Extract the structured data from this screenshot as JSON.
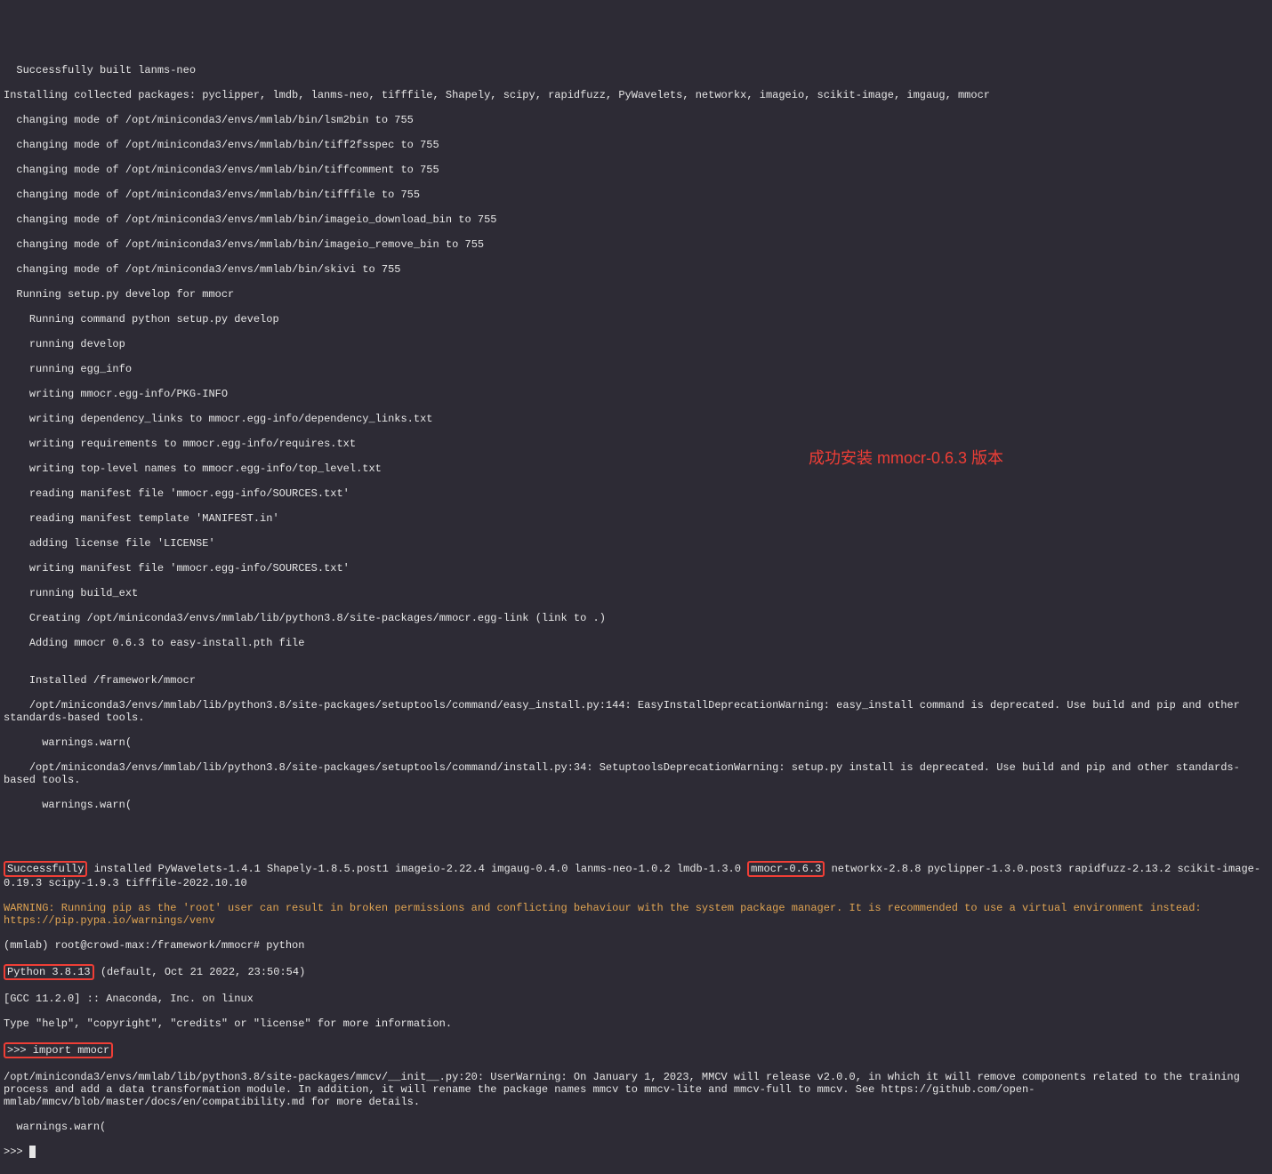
{
  "lines": {
    "l0": "  Successfully built lanms-neo",
    "l1": "Installing collected packages: pyclipper, lmdb, lanms-neo, tifffile, Shapely, scipy, rapidfuzz, PyWavelets, networkx, imageio, scikit-image, imgaug, mmocr",
    "l2": "  changing mode of /opt/miniconda3/envs/mmlab/bin/lsm2bin to 755",
    "l3": "  changing mode of /opt/miniconda3/envs/mmlab/bin/tiff2fsspec to 755",
    "l4": "  changing mode of /opt/miniconda3/envs/mmlab/bin/tiffcomment to 755",
    "l5": "  changing mode of /opt/miniconda3/envs/mmlab/bin/tifffile to 755",
    "l6": "  changing mode of /opt/miniconda3/envs/mmlab/bin/imageio_download_bin to 755",
    "l7": "  changing mode of /opt/miniconda3/envs/mmlab/bin/imageio_remove_bin to 755",
    "l8": "  changing mode of /opt/miniconda3/envs/mmlab/bin/skivi to 755",
    "l9": "  Running setup.py develop for mmocr",
    "l10": "    Running command python setup.py develop",
    "l11": "    running develop",
    "l12": "    running egg_info",
    "l13": "    writing mmocr.egg-info/PKG-INFO",
    "l14": "    writing dependency_links to mmocr.egg-info/dependency_links.txt",
    "l15": "    writing requirements to mmocr.egg-info/requires.txt",
    "l16": "    writing top-level names to mmocr.egg-info/top_level.txt",
    "l17": "    reading manifest file 'mmocr.egg-info/SOURCES.txt'",
    "l18": "    reading manifest template 'MANIFEST.in'",
    "l19": "    adding license file 'LICENSE'",
    "l20": "    writing manifest file 'mmocr.egg-info/SOURCES.txt'",
    "l21": "    running build_ext",
    "l22": "    Creating /opt/miniconda3/envs/mmlab/lib/python3.8/site-packages/mmocr.egg-link (link to .)",
    "l23": "    Adding mmocr 0.6.3 to easy-install.pth file",
    "l24": "",
    "l25": "    Installed /framework/mmocr",
    "l26": "    /opt/miniconda3/envs/mmlab/lib/python3.8/site-packages/setuptools/command/easy_install.py:144: EasyInstallDeprecationWarning: easy_install command is deprecated. Use build and pip and other standards-based tools.",
    "l27": "      warnings.warn(",
    "l28": "    /opt/miniconda3/envs/mmlab/lib/python3.8/site-packages/setuptools/command/install.py:34: SetuptoolsDeprecationWarning: setup.py install is deprecated. Use build and pip and other standards-based tools.",
    "l29": "      warnings.warn(",
    "success_pre": "Successfully",
    "success_mid": " installed PyWavelets-1.4.1 Shapely-1.8.5.post1 imageio-2.22.4 imgaug-0.4.0 lanms-neo-1.0.2 lmdb-1.3.0 ",
    "success_pkg": "mmocr-0.6.3",
    "success_post": " networkx-2.8.8 pyclipper-1.3.0.post3 rapidfuzz-2.13.2 scikit-image-0.19.3 scipy-1.9.3 tifffile-2022.10.10",
    "warn1": "WARNING: Running pip as the 'root' user can result in broken permissions and conflicting behaviour with the system package manager. It is recommended to use a virtual environment instead: https://pip.pypa.io/warnings/venv",
    "shell_prompt": "(mmlab) root@crowd-max:/framework/mmocr# python",
    "pyver": "Python 3.8.13",
    "pyver_suffix": " (default, Oct 21 2022, 23:50:54)",
    "gcc": "[GCC 11.2.0] :: Anaconda, Inc. on linux",
    "help": "Type \"help\", \"copyright\", \"credits\" or \"license\" for more information.",
    "import": ">>> import mmocr",
    "mmcv_warn": "/opt/miniconda3/envs/mmlab/lib/python3.8/site-packages/mmcv/__init__.py:20: UserWarning: On January 1, 2023, MMCV will release v2.0.0, in which it will remove components related to the training process and add a data transformation module. In addition, it will rename the package names mmcv to mmcv-lite and mmcv-full to mmcv. See https://github.com/open-mmlab/mmcv/blob/master/docs/en/compatibility.md for more details.",
    "warnwarn": "  warnings.warn(",
    "pyprompt": ">>> "
  },
  "annotation": "成功安装 mmocr-0.6.3 版本"
}
